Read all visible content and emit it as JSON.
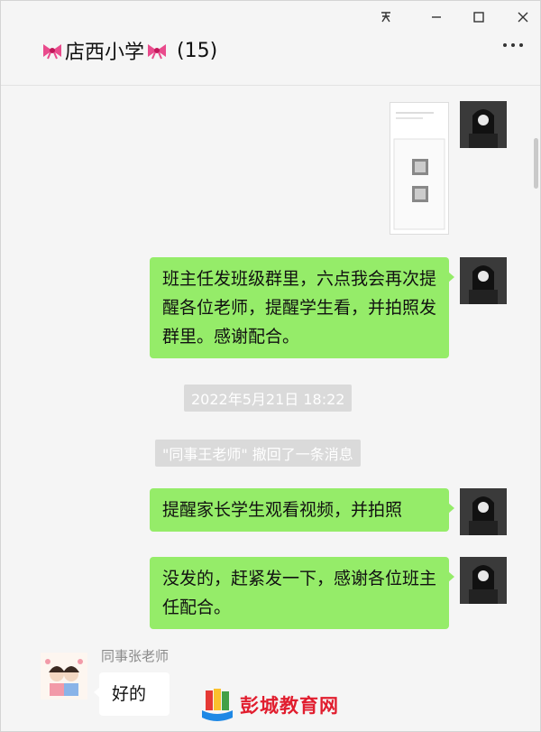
{
  "window": {
    "pin_icon": "pin-icon",
    "minimize_icon": "minimize-icon",
    "maximize_icon": "maximize-icon",
    "close_icon": "close-icon"
  },
  "header": {
    "title": "店西小学",
    "member_count": "(15)",
    "more_icon": "more-icon",
    "bow_icon": "pink-bow-icon"
  },
  "messages": [
    {
      "type": "image",
      "side": "right"
    },
    {
      "type": "text",
      "side": "right",
      "text": "班主任发班级群里，六点我会再次提醒各位老师，提醒学生看，并拍照发群里。感谢配合。"
    },
    {
      "type": "time",
      "text": "2022年5月21日 18:22"
    },
    {
      "type": "system",
      "text": "\"同事王老师\" 撤回了一条消息"
    },
    {
      "type": "text",
      "side": "right",
      "text": "提醒家长学生观看视频，并拍照"
    },
    {
      "type": "text",
      "side": "right",
      "text": "没发的，赶紧发一下，感谢各位班主任配合。"
    },
    {
      "type": "text",
      "side": "left",
      "sender": "同事张老师",
      "text": "好的"
    }
  ],
  "watermark": {
    "text": "彭城教育网"
  },
  "colors": {
    "bubble_mine": "#95ec69",
    "bubble_other": "#ffffff",
    "background": "#f5f5f5",
    "watermark": "#e11d2e"
  }
}
